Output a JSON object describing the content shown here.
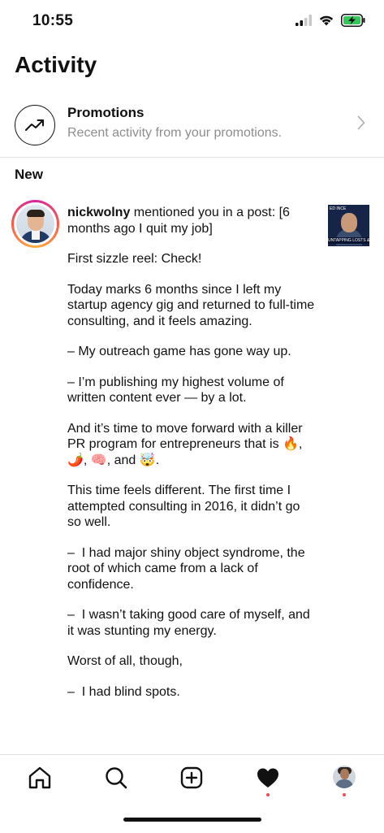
{
  "status_bar": {
    "time": "10:55"
  },
  "header": {
    "title": "Activity"
  },
  "promotions": {
    "title": "Promotions",
    "subtitle": "Recent activity from your promotions.",
    "icon": "trending-up-icon"
  },
  "sections": {
    "new_label": "New"
  },
  "notification": {
    "username": "nickwolny",
    "action_text": " mentioned you in a post: [6 months ago I quit my job]",
    "body": [
      "First sizzle reel: Check!",
      "Today marks 6 months since I left my startup agency gig and returned to full-time consulting, and it feels amazing.",
      "– My outreach game has gone way up.",
      "– I’m publishing my highest volume of written content ever — by a lot.",
      "And it’s time to move forward with a killer PR program for entrepreneurs that is 🔥, 🌶️, 🧠, and 🤯.",
      "This time feels different. The first time I attempted consulting in 2016, it didn’t go so well.",
      "–  I had major shiny object syndrome, the root of which came from a lack of confidence.",
      "–  I wasn’t taking good care of myself, and it was stunting my energy.",
      "Worst of all, though,",
      "–  I had blind spots."
    ],
    "thumbnail_top_text": "ED INCE",
    "thumbnail_banner_text": "UNTAPPING LOSTS & BUYING POWER"
  },
  "tab_bar": {
    "items": [
      "home-icon",
      "search-icon",
      "new-post-icon",
      "activity-heart-icon",
      "profile-avatar"
    ],
    "active": "activity-heart-icon",
    "notification_dot_color": "#ed4956"
  }
}
